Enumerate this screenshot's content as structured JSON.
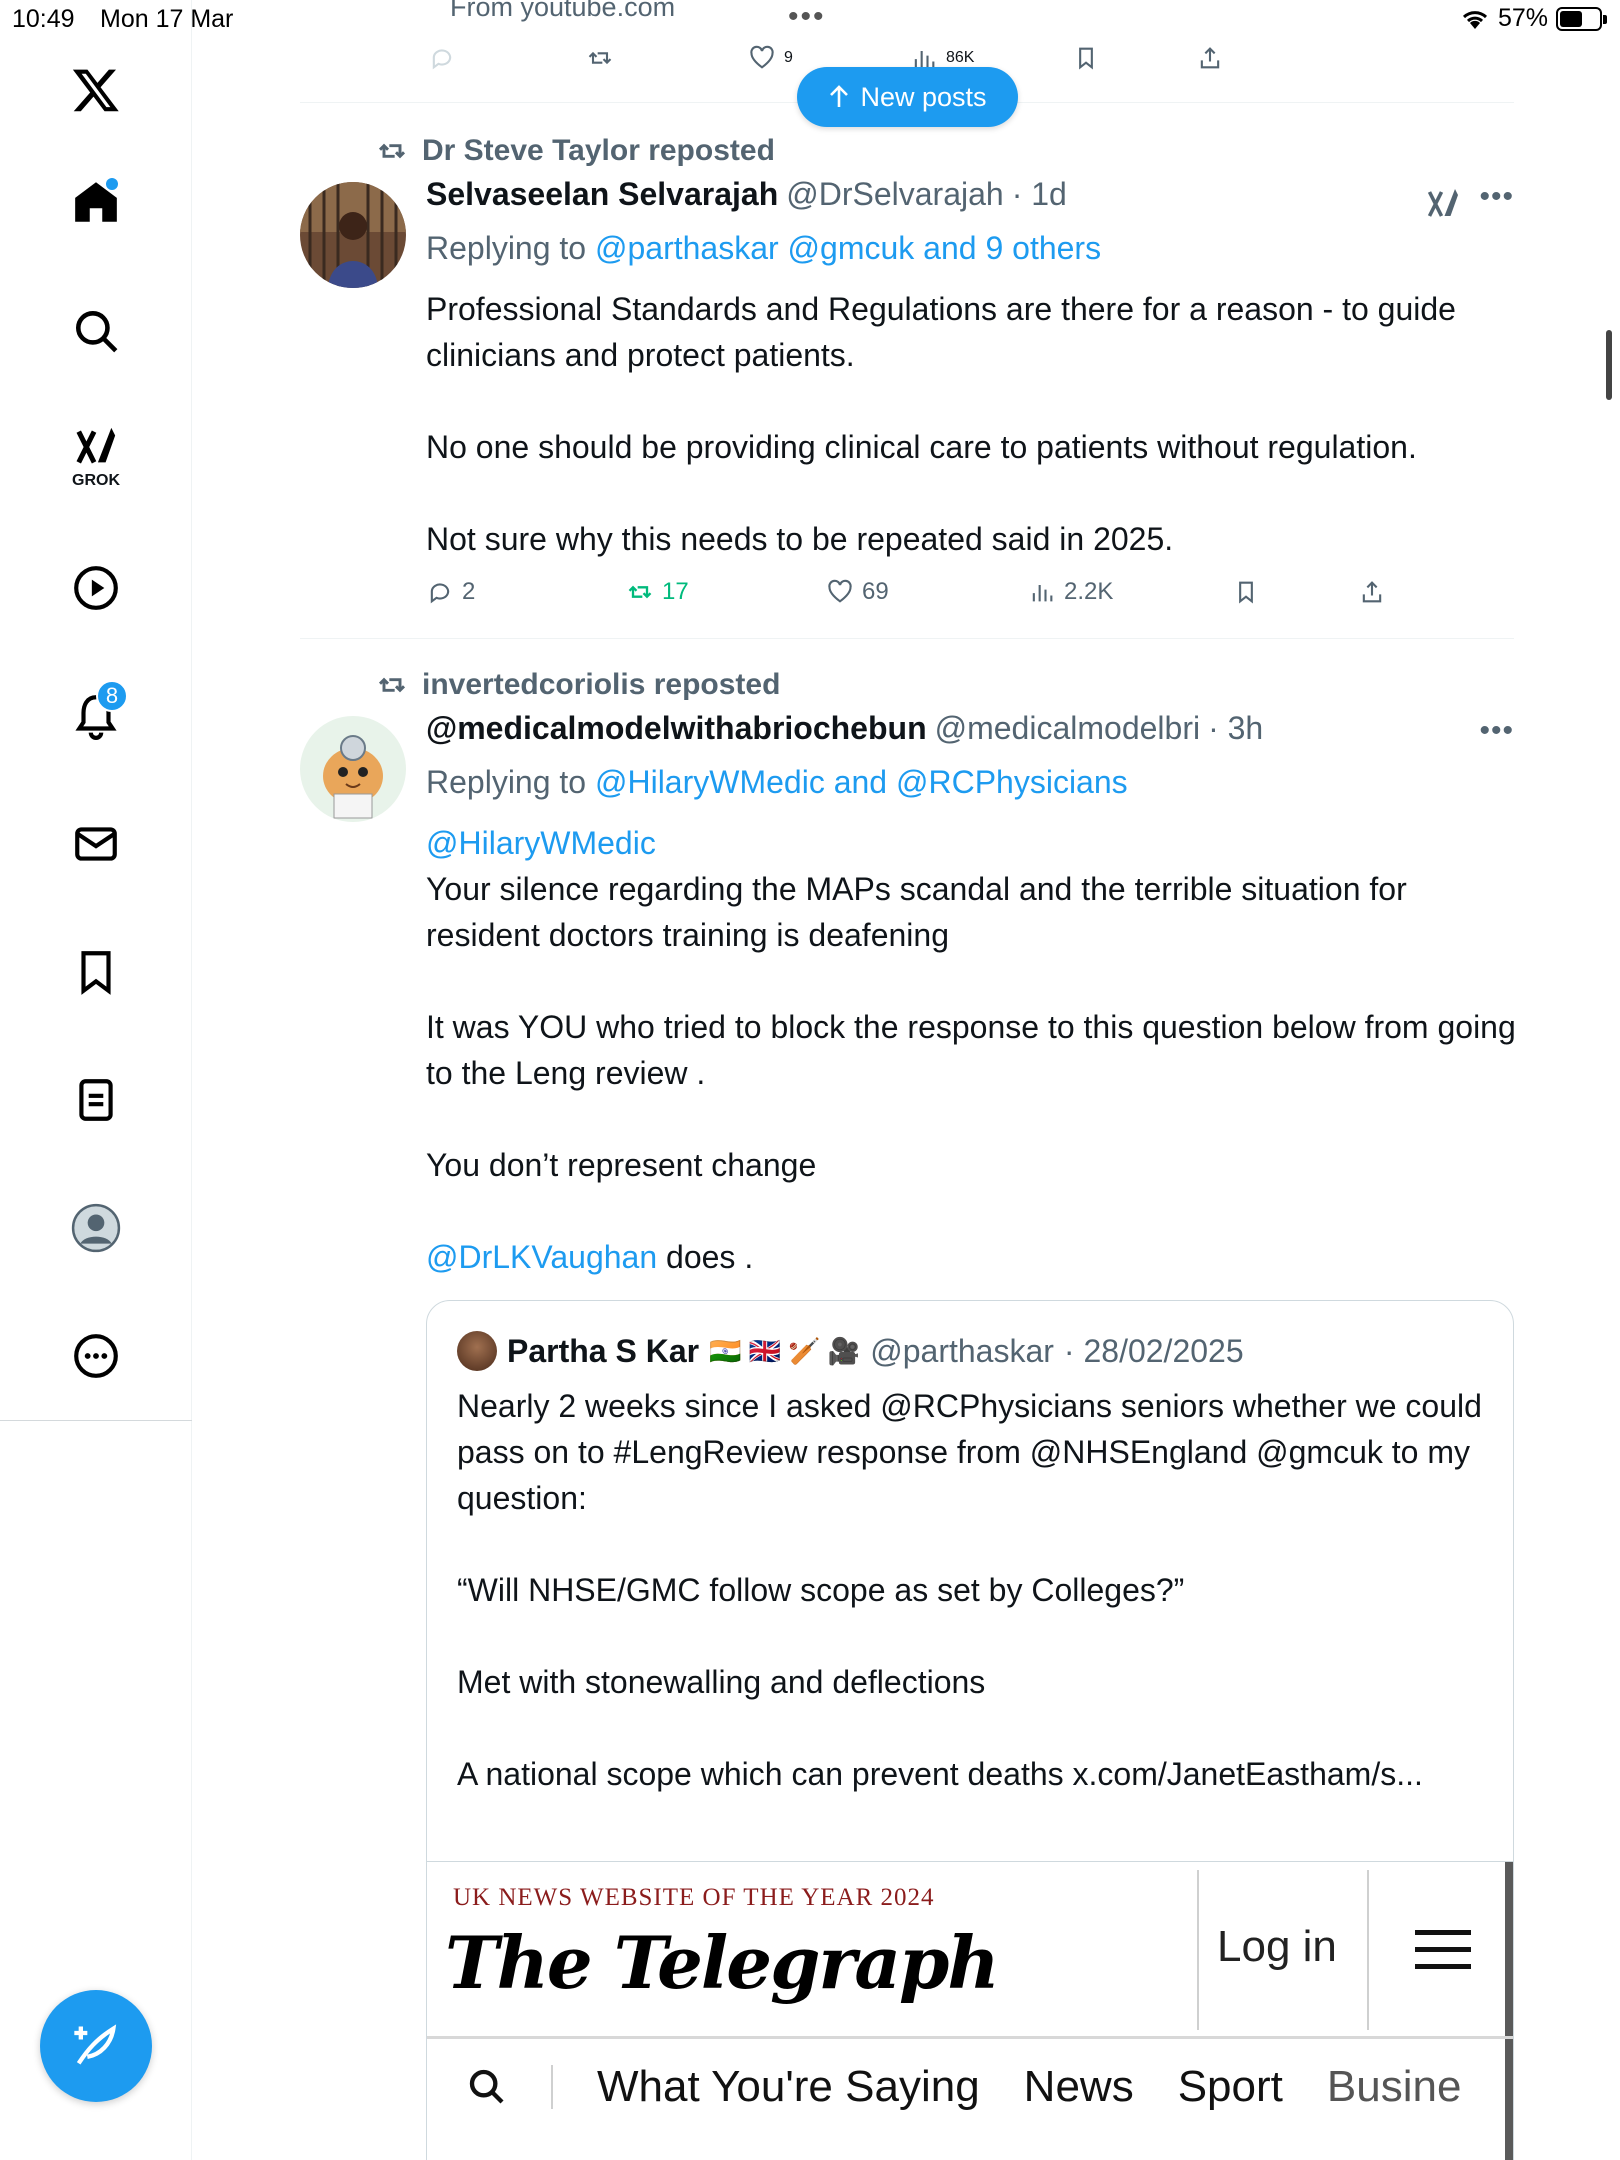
{
  "status_bar": {
    "time": "10:49",
    "date": "Mon 17 Mar",
    "battery": "57%",
    "battery_level": 0.57
  },
  "sidebar": {
    "items": [
      {
        "name": "x-logo-icon"
      },
      {
        "name": "home-icon",
        "unread": true
      },
      {
        "name": "search-icon"
      },
      {
        "name": "grok-icon",
        "label": "GROK"
      },
      {
        "name": "video-icon"
      },
      {
        "name": "notifications-icon",
        "badge": "8"
      },
      {
        "name": "messages-icon"
      },
      {
        "name": "bookmarks-icon"
      },
      {
        "name": "lists-icon"
      },
      {
        "name": "profile-icon"
      },
      {
        "name": "more-icon"
      }
    ]
  },
  "feed": {
    "partial_top": {
      "source": "From youtube.com",
      "likes": "9",
      "views": "86K"
    },
    "new_posts_label": "New posts",
    "posts": [
      {
        "reposted_by": "Dr Steve Taylor reposted",
        "name": "Selvaseelan Selvarajah",
        "handle": "@DrSelvarajah",
        "time": "· 1d",
        "replying_prefix": "Replying to",
        "replying_to": "@parthaskar @gmcuk and 9 others",
        "text": [
          "Professional Standards and Regulations are there for a reason - to guide clinicians and protect patients.",
          "No one should be providing clinical care to patients without regulation.",
          "Not sure why this needs to be repeated said in 2025."
        ],
        "replies": "2",
        "reposts": "17",
        "likes": "69",
        "views": "2.2K"
      },
      {
        "reposted_by": "invertedcoriolis reposted",
        "name": "@medicalmodelwithabriochebun",
        "handle": "@medicalmodelbri",
        "time": "· 3h",
        "replying_prefix": "Replying to",
        "replying_to": "@HilaryWMedic and @RCPhysicians",
        "mention_start": "@HilaryWMedic",
        "text": [
          "Your silence regarding the MAPs scandal and the terrible situation for resident doctors training  is deafening",
          "It was YOU who tried to block the response to this question below from going to the Leng review .",
          "You don’t represent change"
        ],
        "mention_end": "@DrLKVaughan",
        "end_text": " does .",
        "quote": {
          "name": "Partha S Kar",
          "emojis": "🇮🇳 🇬🇧 🏏 🎥",
          "handle": "@parthaskar",
          "time": "· 28/02/2025",
          "text": [
            "Nearly 2 weeks since I asked @RCPhysicians seniors whether we could pass on to #LengReview response from @NHSEngland @gmcuk to my question:",
            "“Will NHSE/GMC follow scope as set by Colleges?”",
            "Met with stonewalling and deflections",
            "A national scope which can prevent deaths x.com/JanetEastham/s..."
          ],
          "card": {
            "award": "UK NEWS WEBSITE OF THE YEAR 2024",
            "logo": "The Telegraph",
            "login": "Log in",
            "nav": [
              "What You're Saying",
              "News",
              "Sport",
              "Busine"
            ]
          }
        }
      }
    ]
  },
  "colors": {
    "accent": "#1d9bf0",
    "text": "#0f1419",
    "muted": "#536471",
    "repost_active": "#00ba7c",
    "telegraph_red": "#8b1c1c"
  }
}
